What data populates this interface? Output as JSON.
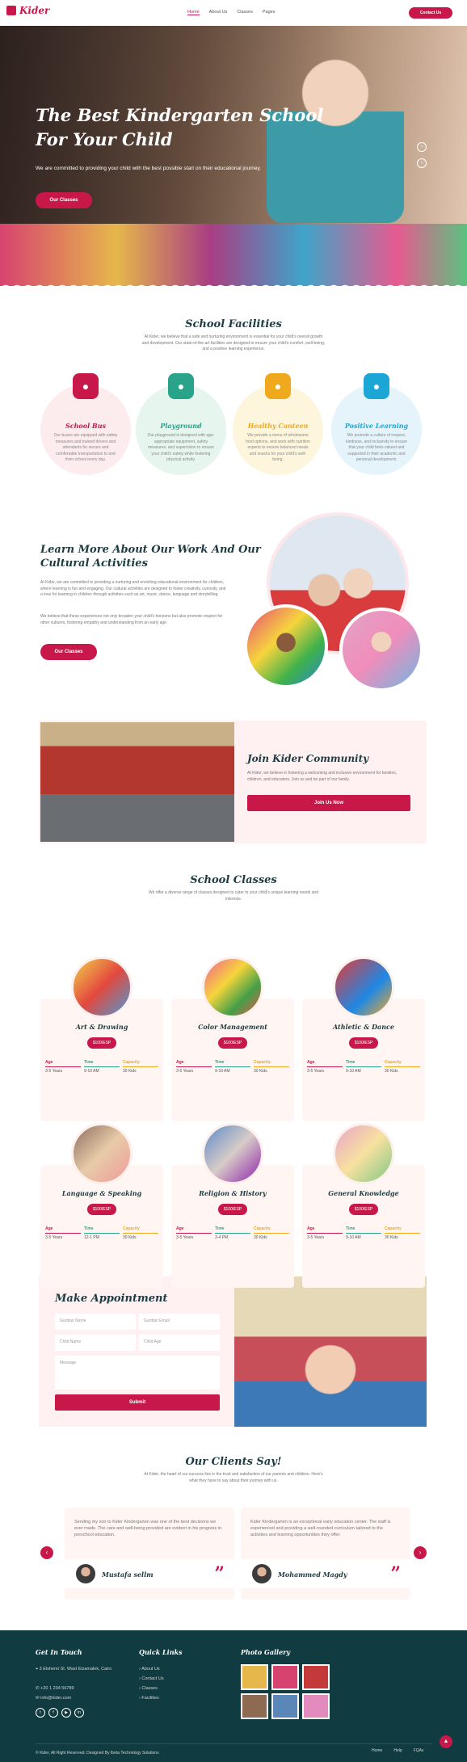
{
  "brand": {
    "name": "Kider"
  },
  "nav": {
    "items": [
      "Home",
      "About Us",
      "Classes",
      "Pages"
    ],
    "cta": "Contact Us"
  },
  "hero": {
    "title_line1": "The Best Kindergarten School",
    "title_line2": "For Your Child",
    "subtitle": "We are committed to providing your child with the best possible start on their educational journey.",
    "button": "Our Classes"
  },
  "facilities": {
    "title": "School Facilities",
    "intro": "At Kider, we believe that a safe and nurturing environment is essential for your child's overall growth and development. Our state-of-the-art facilities are designed to ensure your child's comfort, well-being, and a positive learning experience.",
    "items": [
      {
        "title": "School Bus",
        "text": "Our buses are equipped with safety measures and trained drivers and attendants for secure and comfortable transportation to and from school every day.",
        "color": "#c8184a",
        "bg": "#fdecee",
        "icon": "bus-icon"
      },
      {
        "title": "Playground",
        "text": "Our playground is designed with age-appropriate equipment, safety measures, and supervision to ensure your child's safety while fostering physical activity.",
        "color": "#29a38a",
        "bg": "#e6f5ee",
        "icon": "football-icon"
      },
      {
        "title": "Healthy Canteen",
        "text": "We provide a menu of wholesome food options, and work with nutrition experts to ensure balanced meals and snacks for your child's well-being.",
        "color": "#f0a91c",
        "bg": "#fdf6dd",
        "icon": "home-icon"
      },
      {
        "title": "Positive Learning",
        "text": "We promote a culture of respect, kindness, and inclusivity to ensure that your child feels valued and supported in their academic and personal development.",
        "color": "#1ca6d6",
        "bg": "#e4f4fa",
        "icon": "learning-icon"
      }
    ]
  },
  "about": {
    "title_line1": "Learn More About Our Work And Our",
    "title_line2": "Cultural Activities",
    "p1": "At Kider, we are committed to providing a nurturing and enriching educational environment for children, where learning is fun and engaging. Our cultural activities are designed to foster creativity, curiosity, and a love for learning in children through activities such as art, music, dance, language and storytelling.",
    "p2": "We believe that these experiences not only broaden your child's horizons but also promote respect for other cultures, fostering empathy and understanding from an early age.",
    "button": "Our Classes"
  },
  "community": {
    "title": "Join Kider Community",
    "text": "At Kider, we believe in fostering a welcoming and inclusive environment for families, children, and educators. Join us and be part of our family.",
    "button": "Join Us Now"
  },
  "classes": {
    "title": "School Classes",
    "intro": "We offer a diverse range of classes designed to cater to your child's unique learning needs and interests.",
    "labels": {
      "age": "Age",
      "time": "Time",
      "capacity": "Capacity"
    },
    "items": [
      {
        "name": "Art & Drawing",
        "price": "$100/ESP",
        "age": "3-5 Years",
        "time": "9-10 AM",
        "capacity": "30 Kids"
      },
      {
        "name": "Color Management",
        "price": "$100/ESP",
        "age": "3-5 Years",
        "time": "9-10 AM",
        "capacity": "30 Kids"
      },
      {
        "name": "Athletic & Dance",
        "price": "$100/ESP",
        "age": "3-5 Years",
        "time": "9-10 AM",
        "capacity": "30 Kids"
      },
      {
        "name": "Language & Speaking",
        "price": "$100/ESP",
        "age": "3-5 Years",
        "time": "12-1 PM",
        "capacity": "30 Kids"
      },
      {
        "name": "Religion & History",
        "price": "$100/ESP",
        "age": "3-5 Years",
        "time": "3-4 PM",
        "capacity": "30 Kids"
      },
      {
        "name": "General Knowledge",
        "price": "$100/ESP",
        "age": "3-5 Years",
        "time": "9-10 AM",
        "capacity": "30 Kids"
      }
    ]
  },
  "appointment": {
    "title": "Make Appointment",
    "guardian_name": "Gurdian Name",
    "guardian_email": "Gurdian Email",
    "child_name": "Child Name",
    "child_age": "Child Age",
    "message": "Message",
    "submit": "Submit"
  },
  "testimonials": {
    "title": "Our Clients Say!",
    "intro": "At Kider, the heart of our success lies in the trust and satisfaction of our parents and children. Here's what they have to say about their journey with us.",
    "items": [
      {
        "quote": "Sending my son to Kider Kindergarten was one of the best decisions we ever made. The care and well-being provided are evident in his progress in preschool education.",
        "name": "Mustafa sellm"
      },
      {
        "quote": "Kider Kindergarten is an exceptional early education center. The staff is experienced and providing a well-rounded curriculum tailored to the activities and learning opportunities they offer.",
        "name": "Mohammed Magdy"
      }
    ]
  },
  "footer": {
    "contact_title": "Get In Touch",
    "address": "3 Elsherei St. Wast Elzamalek, Cairo",
    "phone": "+20 1 234 56789",
    "email": "info@kider.com",
    "links_title": "Quick Links",
    "links": [
      "About Us",
      "Contact Us",
      "Classes",
      "Facilities"
    ],
    "gallery_title": "Photo Gallery",
    "copyright": "© Kider, All Right Reserved. Designed By Ibeta Technology Solutions",
    "bottom_links": [
      "Home",
      "Help",
      "FQAs"
    ]
  }
}
